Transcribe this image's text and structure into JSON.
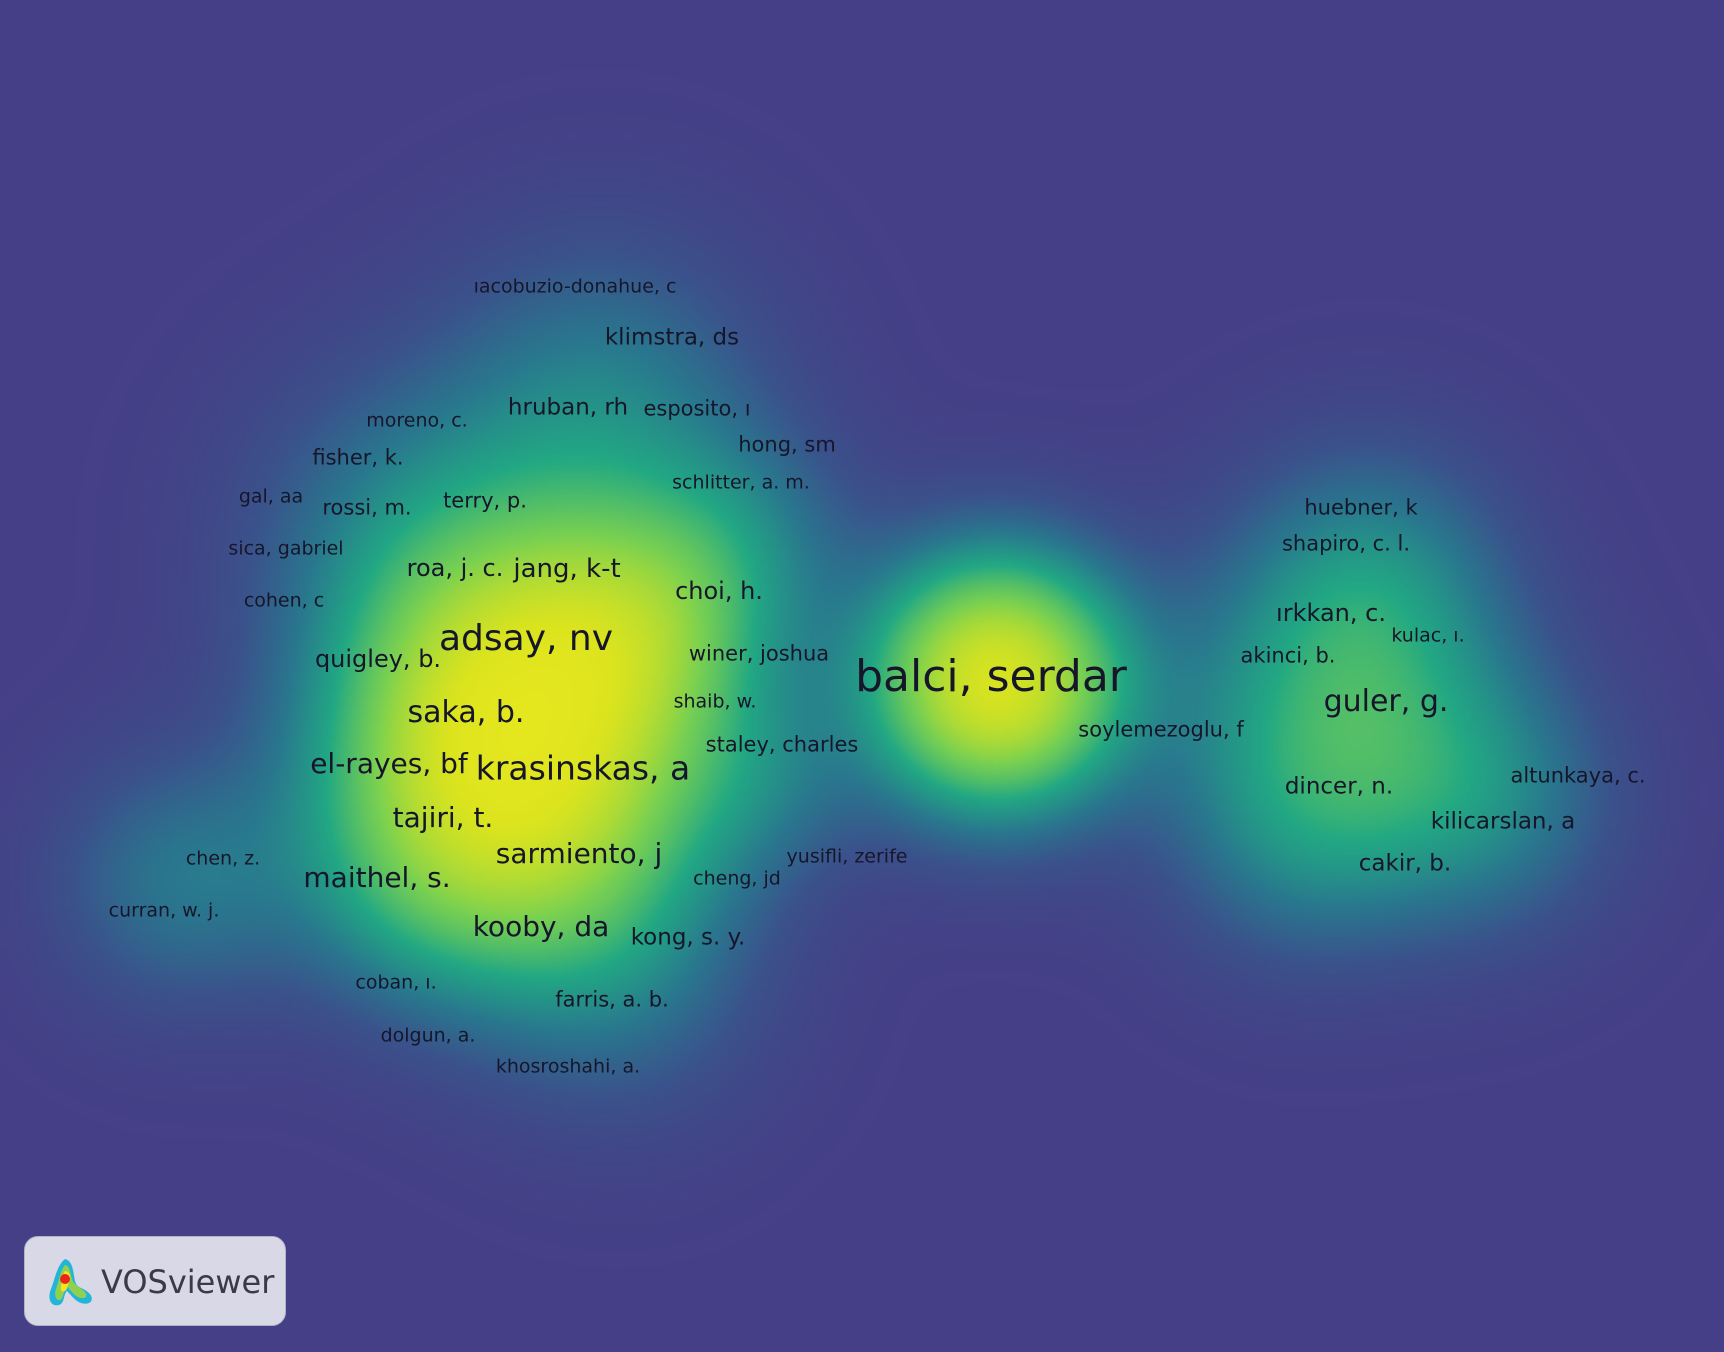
{
  "app": {
    "name": "VOSviewer",
    "view": "density visualization"
  },
  "colors": {
    "background": "#453f87",
    "low": "#3b5a8f",
    "mid": "#2aa07a",
    "high": "#f4eb1e",
    "label_text": "#16162a",
    "logo_bg": "#d8d8e6"
  },
  "nodes": [
    {
      "id": "n1",
      "label": "ıacobuzio-donahue, c"
    },
    {
      "id": "n2",
      "label": "klimstra, ds"
    },
    {
      "id": "n3",
      "label": "moreno, c."
    },
    {
      "id": "n4",
      "label": "hruban, rh"
    },
    {
      "id": "n5",
      "label": "esposito, ı"
    },
    {
      "id": "n6",
      "label": "fisher, k."
    },
    {
      "id": "n7",
      "label": "hong, sm"
    },
    {
      "id": "n8",
      "label": "schlitter, a. m."
    },
    {
      "id": "n9",
      "label": "gal, aa"
    },
    {
      "id": "n10",
      "label": "rossi, m."
    },
    {
      "id": "n11",
      "label": "terry, p."
    },
    {
      "id": "n12",
      "label": "sica, gabriel"
    },
    {
      "id": "n13",
      "label": "roa, j. c."
    },
    {
      "id": "n14",
      "label": "jang, k-t"
    },
    {
      "id": "n15",
      "label": "choi, h."
    },
    {
      "id": "n16",
      "label": "cohen, c"
    },
    {
      "id": "n17",
      "label": "adsay, nv"
    },
    {
      "id": "n18",
      "label": "quigley, b."
    },
    {
      "id": "n19",
      "label": "winer, joshua"
    },
    {
      "id": "n20",
      "label": "balci, serdar"
    },
    {
      "id": "n21",
      "label": "shaib, w."
    },
    {
      "id": "n22",
      "label": "saka, b."
    },
    {
      "id": "n23",
      "label": "staley, charles"
    },
    {
      "id": "n24",
      "label": "el-rayes, bf"
    },
    {
      "id": "n25",
      "label": "krasinskas, a"
    },
    {
      "id": "n26",
      "label": "tajiri, t."
    },
    {
      "id": "n27",
      "label": "sarmiento, j"
    },
    {
      "id": "n28",
      "label": "yusifli, zerife"
    },
    {
      "id": "n29",
      "label": "chen, z."
    },
    {
      "id": "n30",
      "label": "maithel, s."
    },
    {
      "id": "n31",
      "label": "cheng, jd"
    },
    {
      "id": "n32",
      "label": "curran, w. j."
    },
    {
      "id": "n33",
      "label": "kooby, da"
    },
    {
      "id": "n34",
      "label": "kong, s. y."
    },
    {
      "id": "n35",
      "label": "coban, ı."
    },
    {
      "id": "n36",
      "label": "farris, a. b."
    },
    {
      "id": "n37",
      "label": "dolgun, a."
    },
    {
      "id": "n38",
      "label": "khosroshahi, a."
    },
    {
      "id": "n39",
      "label": "soylemezoglu, f"
    },
    {
      "id": "n40",
      "label": "huebner, k"
    },
    {
      "id": "n41",
      "label": "shapiro, c. l."
    },
    {
      "id": "n42",
      "label": "ırkkan, c."
    },
    {
      "id": "n43",
      "label": "kulac, ı."
    },
    {
      "id": "n44",
      "label": "akinci, b."
    },
    {
      "id": "n45",
      "label": "guler, g."
    },
    {
      "id": "n46",
      "label": "altunkaya, c."
    },
    {
      "id": "n47",
      "label": "dincer, n."
    },
    {
      "id": "n48",
      "label": "kilicarslan, a"
    },
    {
      "id": "n49",
      "label": "cakir, b."
    }
  ]
}
